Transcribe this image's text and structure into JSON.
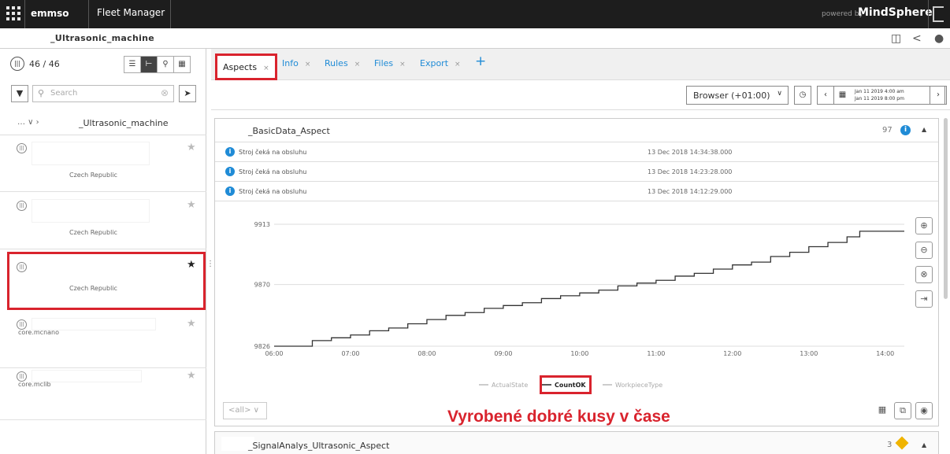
{
  "topbar": {
    "app_short": "emmso",
    "app_name": "Fleet Manager",
    "powered": "powered by",
    "brand": "MindSphere"
  },
  "subbar": {
    "asset_name": "_Ultrasonic_machine"
  },
  "left": {
    "count": "46 / 46",
    "search_placeholder": "Search",
    "crumb_sep": "… ∨   ›",
    "crumb_name": "_Ultrasonic_machine",
    "assets": [
      {
        "location": "Czech Republic",
        "favorite": false
      },
      {
        "location": "Czech Republic",
        "favorite": false
      },
      {
        "location": "Czech Republic",
        "favorite": true,
        "selected": true
      },
      {
        "location": "core.mcnano",
        "favorite": false
      },
      {
        "location": "core.mclib",
        "favorite": false
      }
    ]
  },
  "tabs": [
    "Aspects",
    "Info",
    "Rules",
    "Files",
    "Export"
  ],
  "toolbar": {
    "timezone": "Browser (+01:00)",
    "range_start": "Jan 11 2019 4:00 am",
    "range_end": "Jan 11 2019 8:00 pm"
  },
  "aspect": {
    "title": "_BasicData_Aspect",
    "event_count": "97",
    "events": [
      {
        "message": "Stroj čeká na obsluhu",
        "time": "13 Dec 2018 14:34:38.000"
      },
      {
        "message": "Stroj čeká na obsluhu",
        "time": "13 Dec 2018 14:23:28.000"
      },
      {
        "message": "Stroj čeká na obsluhu",
        "time": "13 Dec 2018 14:12:29.000"
      }
    ],
    "select_value": "<all>"
  },
  "annotation": "Vyrobené dobré kusy v čase",
  "aspect2": {
    "title": "_SignalAnalys_Ultrasonic_Aspect",
    "count": "3"
  },
  "chart_data": {
    "type": "line",
    "xlabel": "",
    "ylabel": "",
    "x_ticks": [
      "06:00",
      "07:00",
      "08:00",
      "09:00",
      "10:00",
      "11:00",
      "12:00",
      "13:00",
      "14:00"
    ],
    "y_ticks": [
      9826,
      9870,
      9913
    ],
    "ylim": [
      9826,
      9913
    ],
    "xlim": [
      "06:00",
      "14:15"
    ],
    "legend": [
      "ActualState",
      "CountOK",
      "WorkpieceType"
    ],
    "active_series": "CountOK",
    "series": [
      {
        "name": "CountOK",
        "color": "#333333",
        "x": [
          "06:00",
          "06:15",
          "06:30",
          "06:45",
          "07:00",
          "07:15",
          "07:30",
          "07:45",
          "08:00",
          "08:15",
          "08:30",
          "08:45",
          "09:00",
          "09:15",
          "09:30",
          "09:45",
          "10:00",
          "10:15",
          "10:30",
          "10:45",
          "11:00",
          "11:15",
          "11:30",
          "11:45",
          "12:00",
          "12:15",
          "12:30",
          "12:45",
          "13:00",
          "13:15",
          "13:30",
          "13:40",
          "14:00",
          "14:15"
        ],
        "y": [
          9826,
          9826,
          9830,
          9832,
          9834,
          9837,
          9839,
          9842,
          9845,
          9848,
          9850,
          9853,
          9855,
          9857,
          9860,
          9862,
          9864,
          9866,
          9869,
          9871,
          9873,
          9876,
          9878,
          9881,
          9884,
          9886,
          9890,
          9893,
          9897,
          9900,
          9904,
          9908,
          9908,
          9908
        ]
      }
    ]
  }
}
